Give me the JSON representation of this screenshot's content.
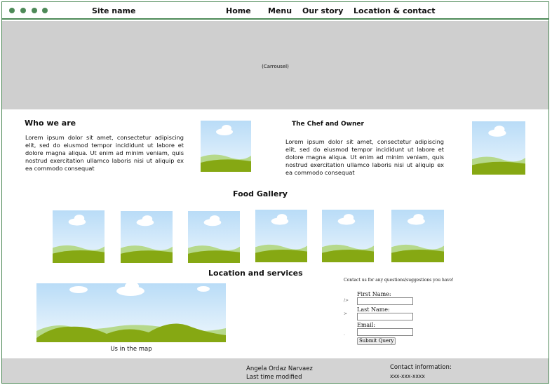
{
  "header": {
    "site_name": "Site name",
    "nav": [
      "Home",
      "Menu",
      "Our story",
      "Location & contact"
    ]
  },
  "carousel": {
    "label": "(Carrousel)"
  },
  "who": {
    "title": "Who we are",
    "text": "Lorem ipsum dolor sit amet, consectetur adipiscing elit, sed do eiusmod tempor incididunt ut labore et dolore magna aliqua. Ut enim ad minim veniam, quis nostrud exercitation ullamco laboris nisi ut aliquip ex ea commodo consequat"
  },
  "chef": {
    "title": "The Chef and Owner",
    "text": "Lorem ipsum dolor sit amet, consectetur adipiscing elit, sed do eiusmod tempor incididunt ut labore et dolore magna aliqua. Ut enim ad minim veniam, quis nostrud exercitation ullamco laboris nisi ut aliquip ex ea commodo consequat"
  },
  "gallery": {
    "title": "Food Gallery"
  },
  "location": {
    "title": "Location and services",
    "map_caption": "Us in the map"
  },
  "form": {
    "intro": "Contact us for any questions/suggestions you have!",
    "first_name_label": "First Name:",
    "last_name_label": "Last Name:",
    "email_label": "Email:",
    "submit_label": "Submit Query"
  },
  "footer": {
    "author": "Angela Ordaz Narvaez",
    "modified": "Last time modified",
    "contact_label": "Contact information:",
    "phone": "xxx-xxx-xxxx"
  },
  "colors": {
    "accent": "#4e8a58",
    "carousel_bg": "#cfcfcf",
    "footer_bg": "#d3d3d3"
  }
}
